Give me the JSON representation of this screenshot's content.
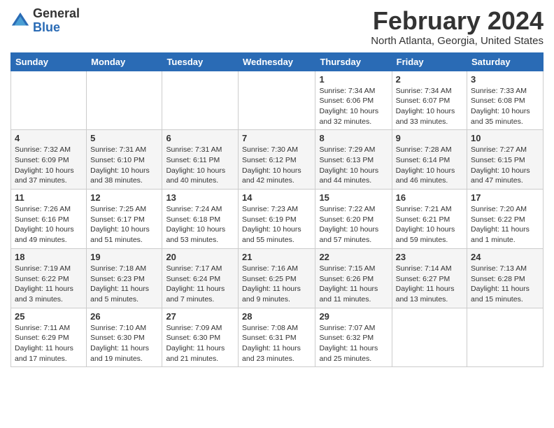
{
  "logo": {
    "general": "General",
    "blue": "Blue"
  },
  "header": {
    "month_year": "February 2024",
    "location": "North Atlanta, Georgia, United States"
  },
  "weekdays": [
    "Sunday",
    "Monday",
    "Tuesday",
    "Wednesday",
    "Thursday",
    "Friday",
    "Saturday"
  ],
  "weeks": [
    [
      {
        "day": "",
        "info": ""
      },
      {
        "day": "",
        "info": ""
      },
      {
        "day": "",
        "info": ""
      },
      {
        "day": "",
        "info": ""
      },
      {
        "day": "1",
        "info": "Sunrise: 7:34 AM\nSunset: 6:06 PM\nDaylight: 10 hours and 32 minutes."
      },
      {
        "day": "2",
        "info": "Sunrise: 7:34 AM\nSunset: 6:07 PM\nDaylight: 10 hours and 33 minutes."
      },
      {
        "day": "3",
        "info": "Sunrise: 7:33 AM\nSunset: 6:08 PM\nDaylight: 10 hours and 35 minutes."
      }
    ],
    [
      {
        "day": "4",
        "info": "Sunrise: 7:32 AM\nSunset: 6:09 PM\nDaylight: 10 hours and 37 minutes."
      },
      {
        "day": "5",
        "info": "Sunrise: 7:31 AM\nSunset: 6:10 PM\nDaylight: 10 hours and 38 minutes."
      },
      {
        "day": "6",
        "info": "Sunrise: 7:31 AM\nSunset: 6:11 PM\nDaylight: 10 hours and 40 minutes."
      },
      {
        "day": "7",
        "info": "Sunrise: 7:30 AM\nSunset: 6:12 PM\nDaylight: 10 hours and 42 minutes."
      },
      {
        "day": "8",
        "info": "Sunrise: 7:29 AM\nSunset: 6:13 PM\nDaylight: 10 hours and 44 minutes."
      },
      {
        "day": "9",
        "info": "Sunrise: 7:28 AM\nSunset: 6:14 PM\nDaylight: 10 hours and 46 minutes."
      },
      {
        "day": "10",
        "info": "Sunrise: 7:27 AM\nSunset: 6:15 PM\nDaylight: 10 hours and 47 minutes."
      }
    ],
    [
      {
        "day": "11",
        "info": "Sunrise: 7:26 AM\nSunset: 6:16 PM\nDaylight: 10 hours and 49 minutes."
      },
      {
        "day": "12",
        "info": "Sunrise: 7:25 AM\nSunset: 6:17 PM\nDaylight: 10 hours and 51 minutes."
      },
      {
        "day": "13",
        "info": "Sunrise: 7:24 AM\nSunset: 6:18 PM\nDaylight: 10 hours and 53 minutes."
      },
      {
        "day": "14",
        "info": "Sunrise: 7:23 AM\nSunset: 6:19 PM\nDaylight: 10 hours and 55 minutes."
      },
      {
        "day": "15",
        "info": "Sunrise: 7:22 AM\nSunset: 6:20 PM\nDaylight: 10 hours and 57 minutes."
      },
      {
        "day": "16",
        "info": "Sunrise: 7:21 AM\nSunset: 6:21 PM\nDaylight: 10 hours and 59 minutes."
      },
      {
        "day": "17",
        "info": "Sunrise: 7:20 AM\nSunset: 6:22 PM\nDaylight: 11 hours and 1 minute."
      }
    ],
    [
      {
        "day": "18",
        "info": "Sunrise: 7:19 AM\nSunset: 6:22 PM\nDaylight: 11 hours and 3 minutes."
      },
      {
        "day": "19",
        "info": "Sunrise: 7:18 AM\nSunset: 6:23 PM\nDaylight: 11 hours and 5 minutes."
      },
      {
        "day": "20",
        "info": "Sunrise: 7:17 AM\nSunset: 6:24 PM\nDaylight: 11 hours and 7 minutes."
      },
      {
        "day": "21",
        "info": "Sunrise: 7:16 AM\nSunset: 6:25 PM\nDaylight: 11 hours and 9 minutes."
      },
      {
        "day": "22",
        "info": "Sunrise: 7:15 AM\nSunset: 6:26 PM\nDaylight: 11 hours and 11 minutes."
      },
      {
        "day": "23",
        "info": "Sunrise: 7:14 AM\nSunset: 6:27 PM\nDaylight: 11 hours and 13 minutes."
      },
      {
        "day": "24",
        "info": "Sunrise: 7:13 AM\nSunset: 6:28 PM\nDaylight: 11 hours and 15 minutes."
      }
    ],
    [
      {
        "day": "25",
        "info": "Sunrise: 7:11 AM\nSunset: 6:29 PM\nDaylight: 11 hours and 17 minutes."
      },
      {
        "day": "26",
        "info": "Sunrise: 7:10 AM\nSunset: 6:30 PM\nDaylight: 11 hours and 19 minutes."
      },
      {
        "day": "27",
        "info": "Sunrise: 7:09 AM\nSunset: 6:30 PM\nDaylight: 11 hours and 21 minutes."
      },
      {
        "day": "28",
        "info": "Sunrise: 7:08 AM\nSunset: 6:31 PM\nDaylight: 11 hours and 23 minutes."
      },
      {
        "day": "29",
        "info": "Sunrise: 7:07 AM\nSunset: 6:32 PM\nDaylight: 11 hours and 25 minutes."
      },
      {
        "day": "",
        "info": ""
      },
      {
        "day": "",
        "info": ""
      }
    ]
  ]
}
